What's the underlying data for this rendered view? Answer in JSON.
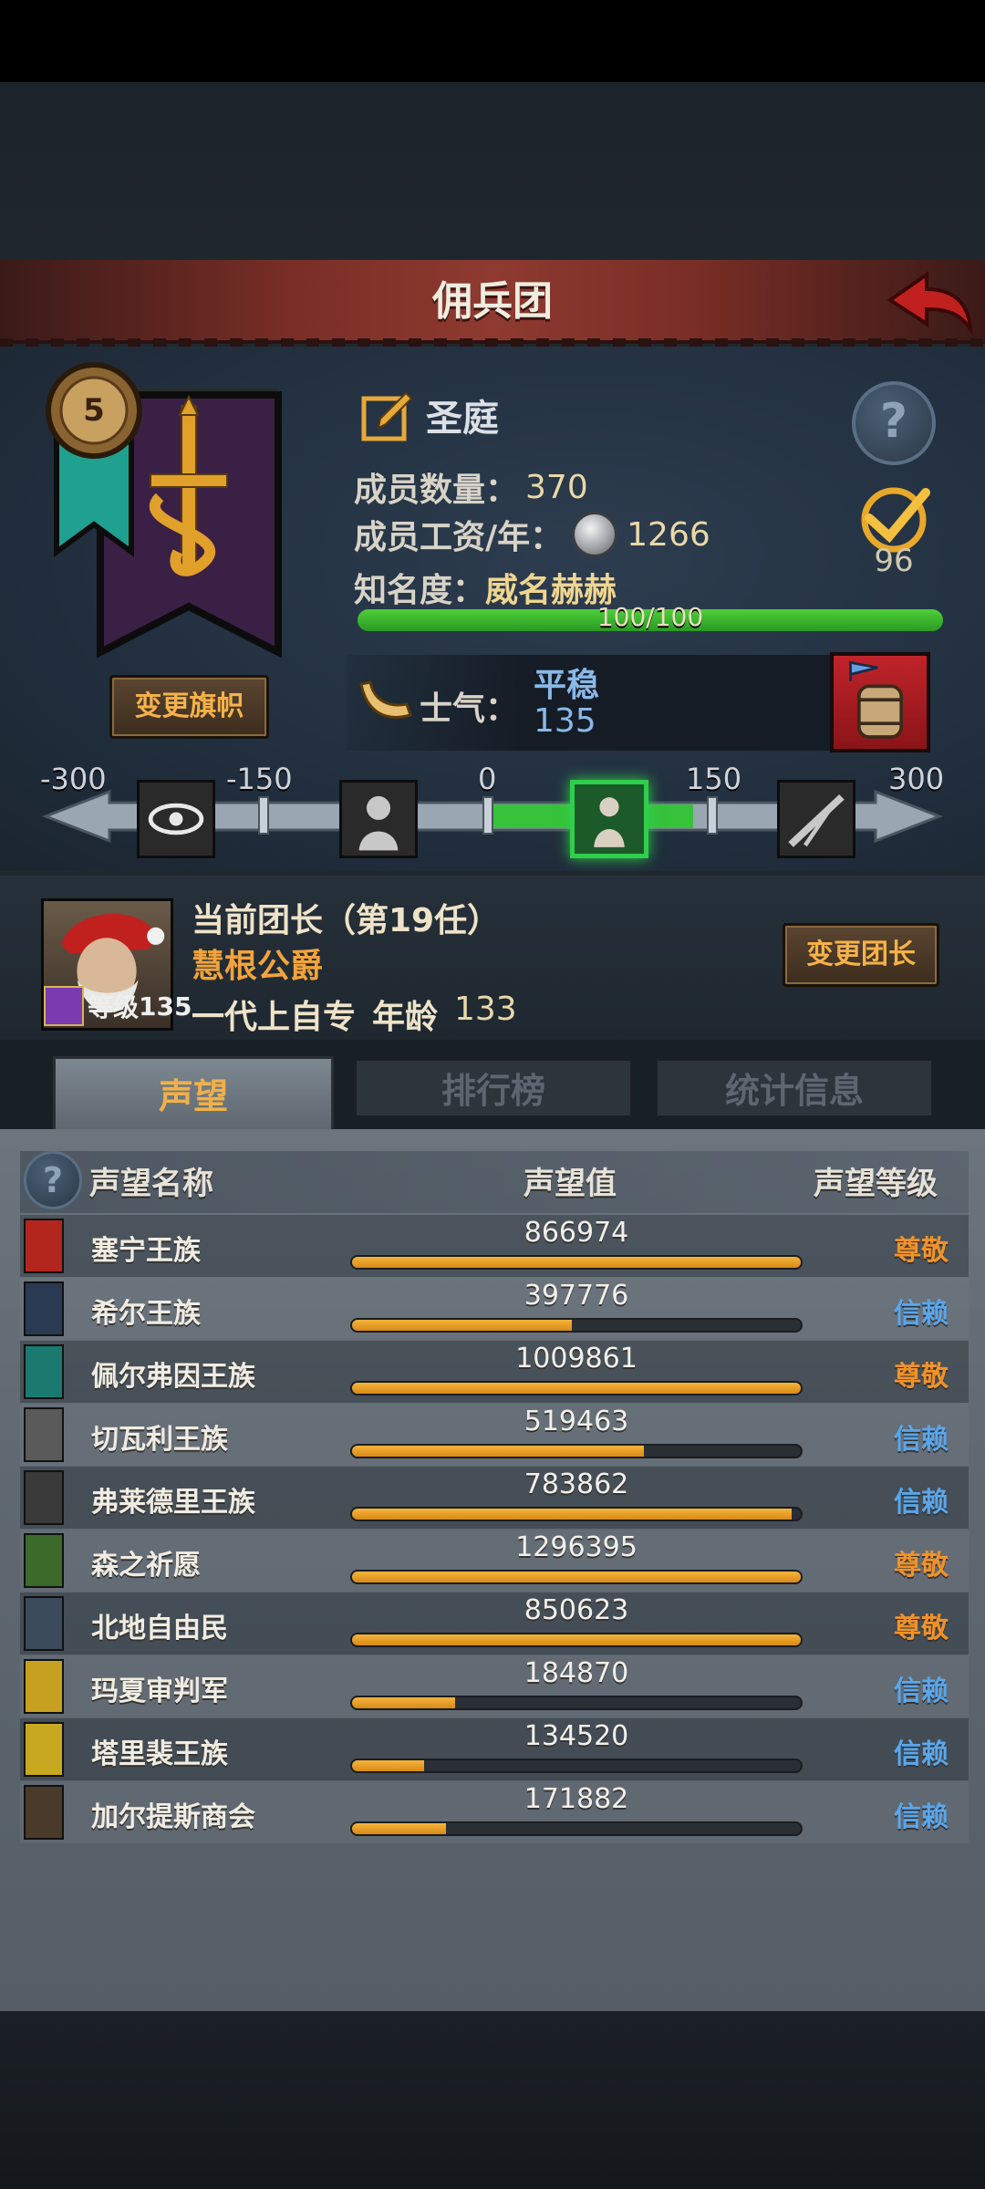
{
  "header": {
    "title": "佣兵团"
  },
  "company": {
    "banner_level": "5",
    "name": "圣庭",
    "change_flag_label": "变更旗帜",
    "members_label": "成员数量：",
    "members_value": "370",
    "wage_label": "成员工资/年：",
    "wage_value": "1266",
    "fame_label": "知名度：",
    "fame_value": "威名赫赫",
    "fame_progress_text": "100/100",
    "fame_progress": 1.0,
    "medal_value": "96",
    "morale_label": "士气：",
    "morale_state": "平稳",
    "morale_value": "135"
  },
  "morale_scale": {
    "labels": [
      "-300",
      "-150",
      "0",
      "150",
      "300"
    ],
    "active_band": "0–150"
  },
  "commander": {
    "title": "当前团长（第19任）",
    "name": "慧根公爵",
    "level_label": "等级",
    "level": "135",
    "trait": "一代上自专",
    "age_label": "年龄",
    "age": "133",
    "change_label": "变更团长"
  },
  "tabs": [
    {
      "label": "声望",
      "active": true
    },
    {
      "label": "排行榜",
      "active": false
    },
    {
      "label": "统计信息",
      "active": false
    }
  ],
  "reputation": {
    "col_name": "声望名称",
    "col_value": "声望值",
    "col_level": "声望等级",
    "rows": [
      {
        "name": "塞宁王族",
        "value": "866974",
        "fill": 1.0,
        "level": "尊敬",
        "level_color": "#f0922a",
        "icon_color": "#b3261e"
      },
      {
        "name": "希尔王族",
        "value": "397776",
        "fill": 0.49,
        "level": "信赖",
        "level_color": "#5aa6ea",
        "icon_color": "#2a3a52"
      },
      {
        "name": "佩尔弗因王族",
        "value": "1009861",
        "fill": 1.0,
        "level": "尊敬",
        "level_color": "#f0922a",
        "icon_color": "#1a7a70"
      },
      {
        "name": "切瓦利王族",
        "value": "519463",
        "fill": 0.65,
        "level": "信赖",
        "level_color": "#5aa6ea",
        "icon_color": "#5a5a5a"
      },
      {
        "name": "弗莱德里王族",
        "value": "783862",
        "fill": 0.98,
        "level": "信赖",
        "level_color": "#5aa6ea",
        "icon_color": "#3a3a3a"
      },
      {
        "name": "森之祈愿",
        "value": "1296395",
        "fill": 1.0,
        "level": "尊敬",
        "level_color": "#f0922a",
        "icon_color": "#3c6a2a"
      },
      {
        "name": "北地自由民",
        "value": "850623",
        "fill": 1.0,
        "level": "尊敬",
        "level_color": "#f0922a",
        "icon_color": "#3a4a5a"
      },
      {
        "name": "玛夏审判军",
        "value": "184870",
        "fill": 0.23,
        "level": "信赖",
        "level_color": "#5aa6ea",
        "icon_color": "#c8a020"
      },
      {
        "name": "塔里裴王族",
        "value": "134520",
        "fill": 0.16,
        "level": "信赖",
        "level_color": "#5aa6ea",
        "icon_color": "#c8a820"
      },
      {
        "name": "加尔提斯商会",
        "value": "171882",
        "fill": 0.21,
        "level": "信赖",
        "level_color": "#5aa6ea",
        "icon_color": "#4a3a2a"
      }
    ]
  }
}
